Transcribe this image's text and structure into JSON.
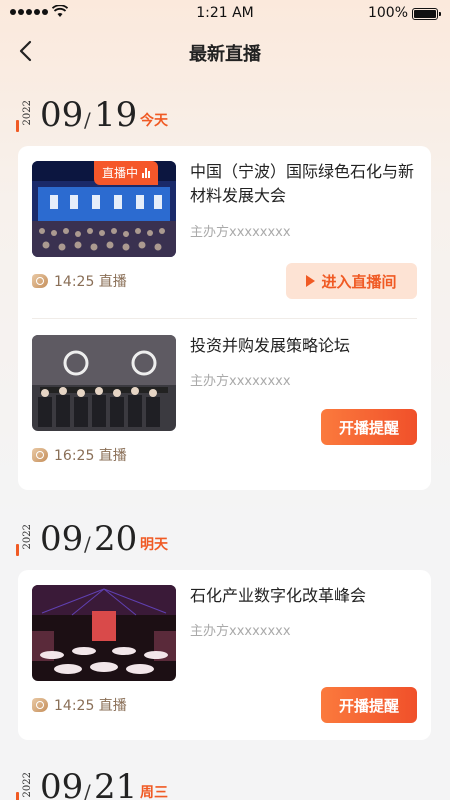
{
  "status": {
    "time": "1:21 AM",
    "battery": "100%"
  },
  "nav": {
    "title": "最新直播"
  },
  "sections": [
    {
      "year": "2022",
      "month": "09",
      "day": "19",
      "relative": "今天",
      "items": [
        {
          "title": "中国（宁波）国际绿色石化与新材料发展大会",
          "organizer": "主办方xxxxxxxx",
          "time_label": "14:25 直播",
          "live_badge": "直播中",
          "action": "进入直播间"
        },
        {
          "title": "投资并购发展策略论坛",
          "organizer": "主办方xxxxxxxx",
          "time_label": "16:25 直播",
          "action": "开播提醒"
        }
      ]
    },
    {
      "year": "2022",
      "month": "09",
      "day": "20",
      "relative": "明天",
      "items": [
        {
          "title": "石化产业数字化改革峰会",
          "organizer": "主办方xxxxxxxx",
          "time_label": "14:25 直播",
          "action": "开播提醒"
        }
      ]
    },
    {
      "year": "2022",
      "month": "09",
      "day": "21",
      "relative": "周三",
      "items": []
    }
  ],
  "colors": {
    "accent": "#f05a24",
    "badge": "#f5572a",
    "enter_bg": "#fde3d4"
  }
}
